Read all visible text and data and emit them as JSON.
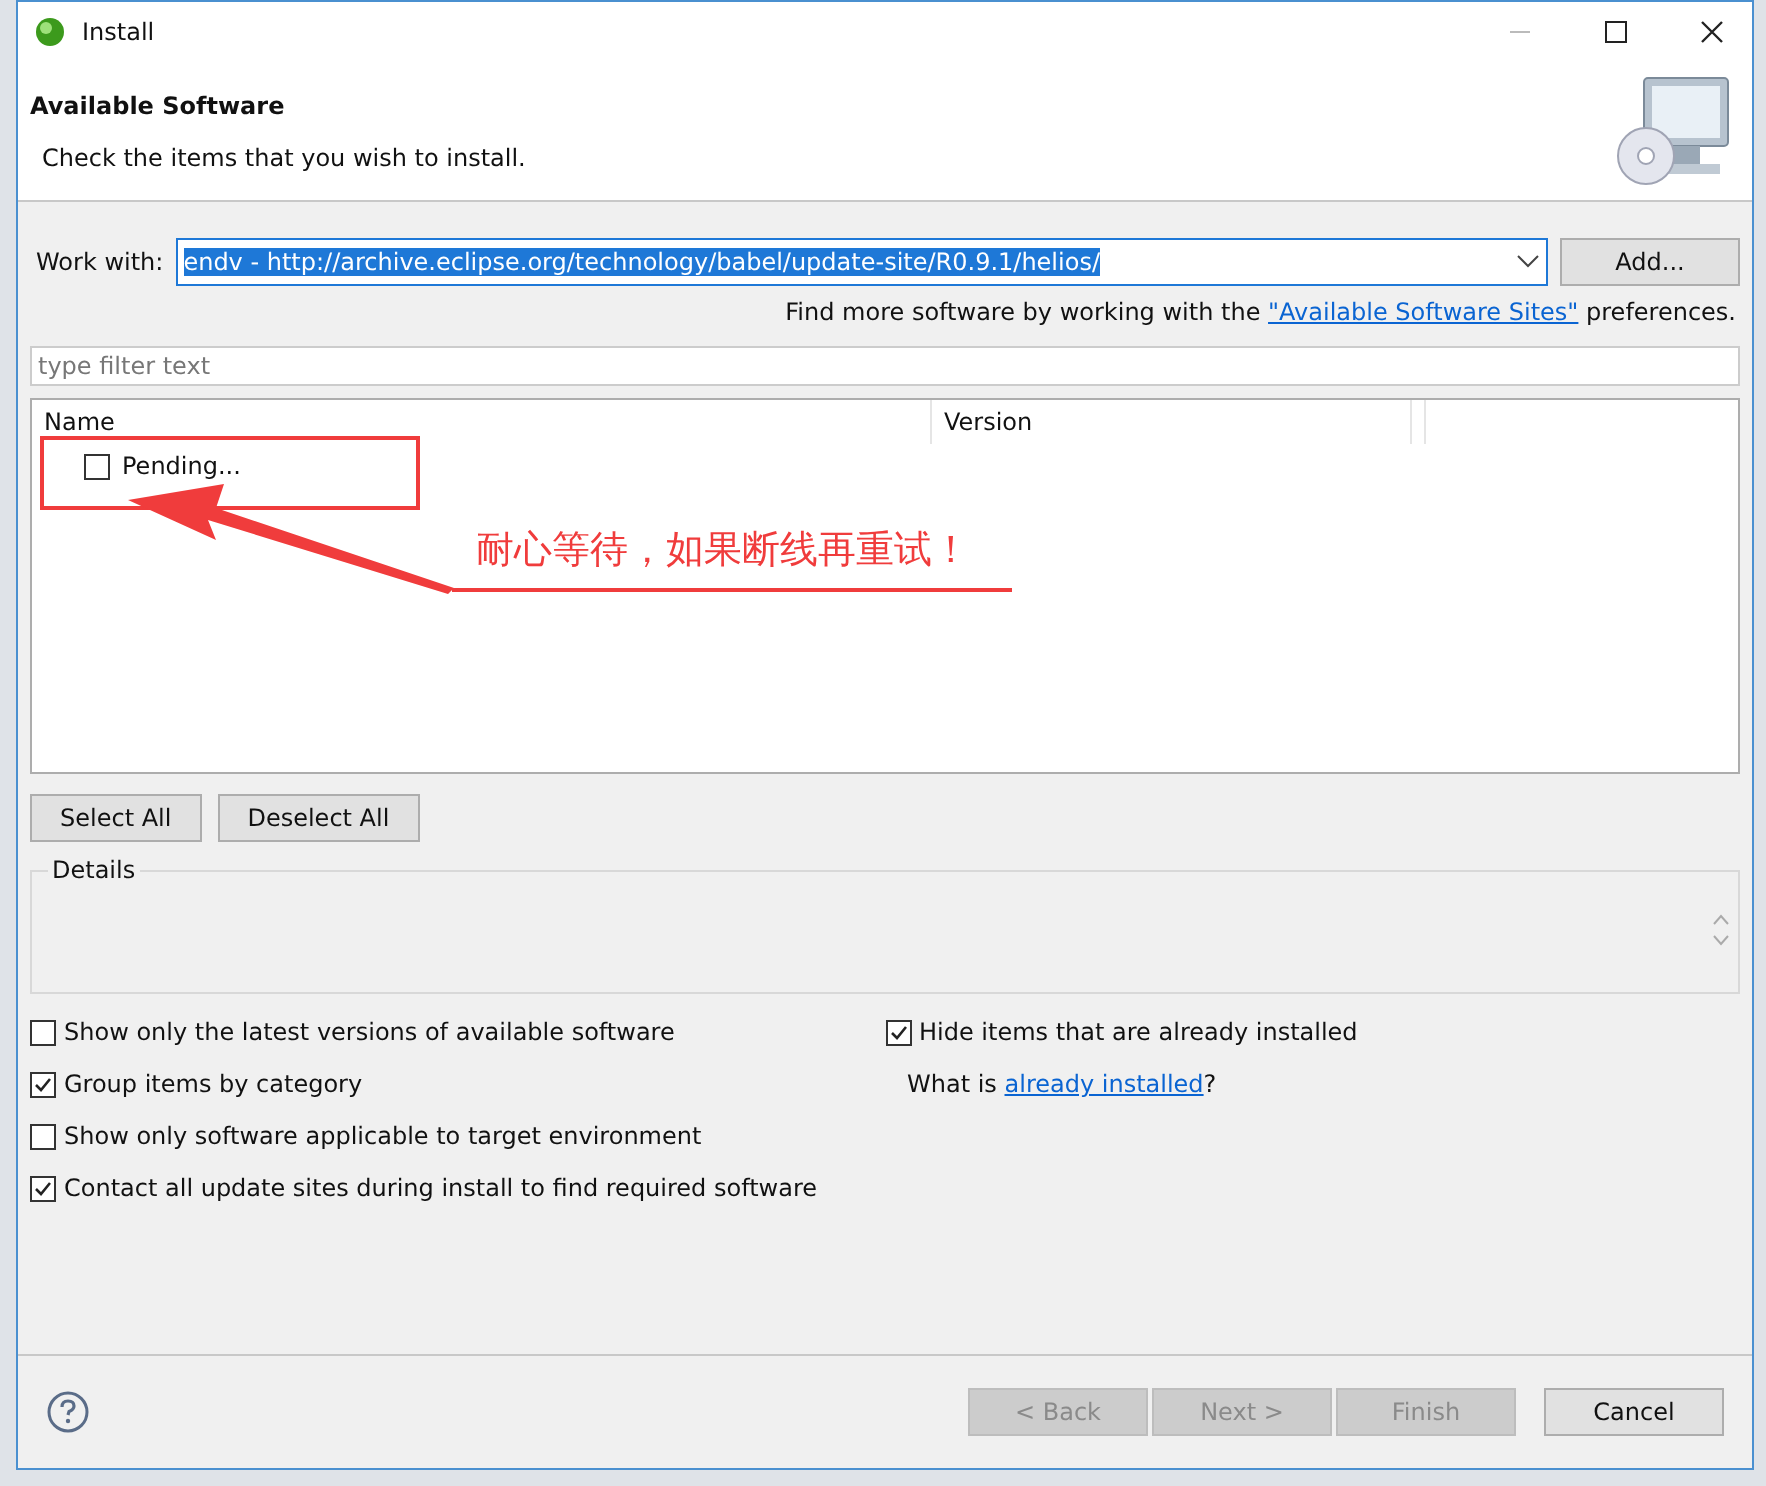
{
  "window": {
    "title": "Install"
  },
  "header": {
    "title": "Available Software",
    "subtitle": "Check the items that you wish to install."
  },
  "work_with": {
    "label": "Work with:",
    "value": "endv - http://archive.eclipse.org/technology/babel/update-site/R0.9.1/helios/",
    "add_button": "Add..."
  },
  "find_more": {
    "before": "Find more software by working with the ",
    "link": "\"Available Software Sites\"",
    "after": " preferences."
  },
  "filter": {
    "placeholder": "type filter text"
  },
  "table": {
    "columns": [
      "Name",
      "Version"
    ],
    "rows": [
      {
        "name": "Pending...",
        "checked": false
      }
    ]
  },
  "annotation": {
    "text": "耐心等待，如果断线再重试！"
  },
  "select_buttons": [
    "Select All",
    "Deselect All"
  ],
  "details": {
    "label": "Details"
  },
  "options_left": [
    {
      "label": "Show only the latest versions of available software",
      "checked": false
    },
    {
      "label": "Group items by category",
      "checked": true
    },
    {
      "label": "Show only software applicable to target environment",
      "checked": false
    },
    {
      "label": "Contact all update sites during install to find required software",
      "checked": true
    }
  ],
  "options_right": [
    {
      "label": "Hide items that are already installed",
      "checked": true
    }
  ],
  "what_is": {
    "before": "What is ",
    "link": "already installed",
    "after": "?"
  },
  "footer_buttons": [
    {
      "label": "< Back",
      "disabled": true
    },
    {
      "label": "Next >",
      "disabled": true
    },
    {
      "label": "Finish",
      "disabled": true
    },
    {
      "label": "Cancel",
      "disabled": false
    }
  ]
}
